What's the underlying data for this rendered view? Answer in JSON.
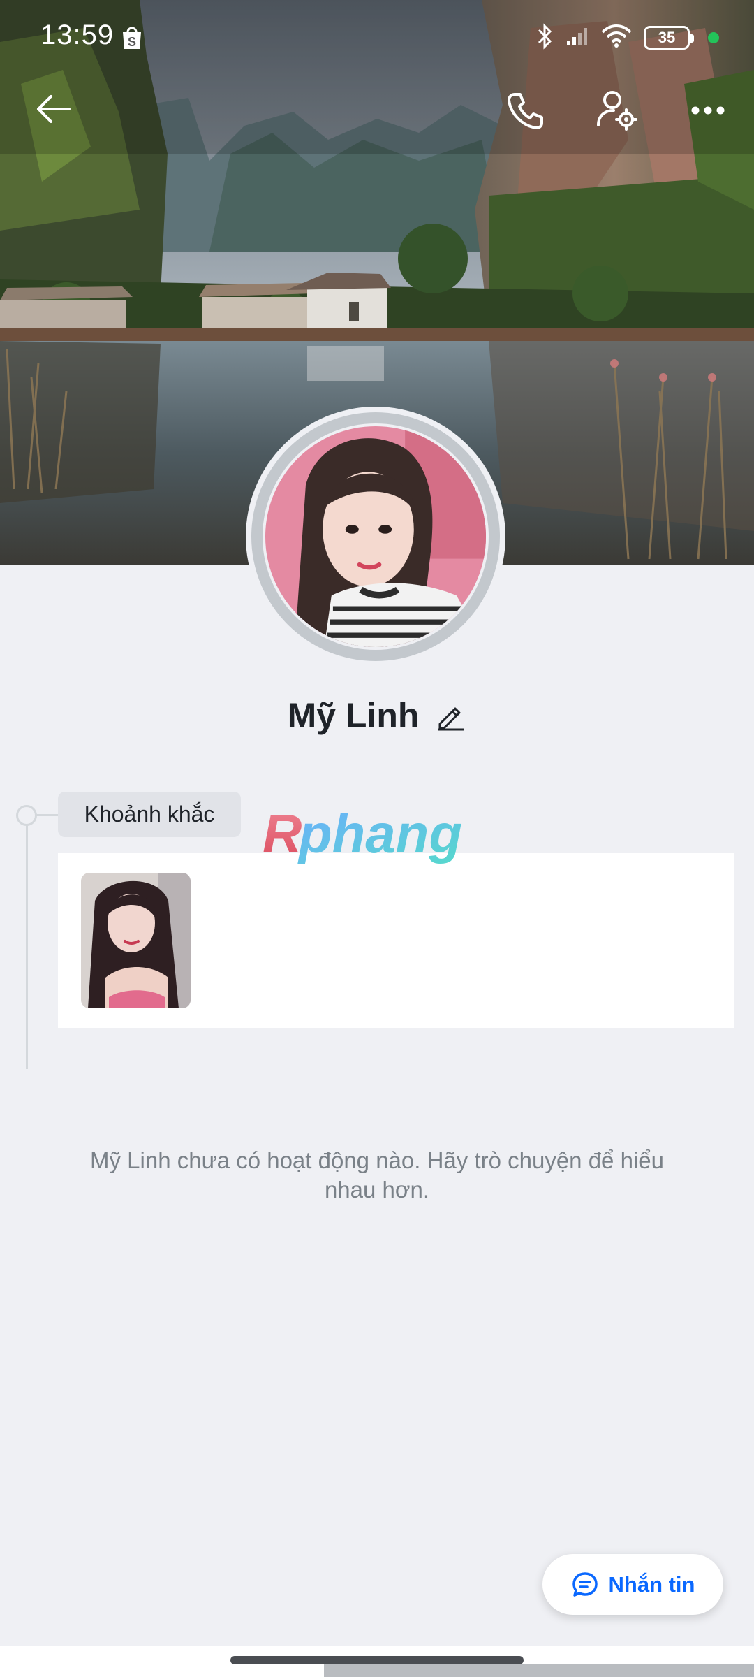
{
  "status_bar": {
    "time": "13:59",
    "battery": "35",
    "icons": [
      "shopee-bag-icon",
      "bluetooth-icon",
      "signal-icon",
      "wifi-icon",
      "battery-icon",
      "active-dot-icon"
    ]
  },
  "header": {
    "icons": [
      "back-arrow-icon",
      "phone-icon",
      "user-settings-icon",
      "more-icon"
    ]
  },
  "profile": {
    "name": "Mỹ Linh"
  },
  "moments": {
    "label": "Khoảnh khắc"
  },
  "watermark": {
    "text": "Rphang"
  },
  "empty_state": {
    "text": "Mỹ Linh chưa có hoạt động nào. Hãy trò chuyện để hiểu nhau hơn."
  },
  "message_button": {
    "label": "Nhắn tin"
  },
  "colors": {
    "accent": "#0a68ff",
    "background": "#eff0f4",
    "name_text": "#1f2329",
    "muted_text": "#7a8188"
  }
}
